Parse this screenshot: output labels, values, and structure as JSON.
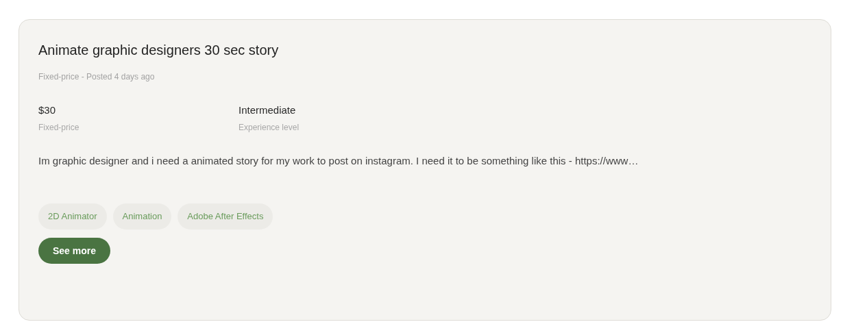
{
  "job": {
    "title": "Animate graphic designers 30 sec story",
    "meta": "Fixed-price - Posted 4 days ago",
    "stats": [
      {
        "value": "$30",
        "label": "Fixed-price"
      },
      {
        "value": "Intermediate",
        "label": "Experience level"
      }
    ],
    "description": "Im graphic designer and i need a animated story for my work to post on instagram. I need it to be something like this - https://www…",
    "skills": [
      "2D Animator",
      "Animation",
      "Adobe After Effects"
    ],
    "button": "See more"
  }
}
